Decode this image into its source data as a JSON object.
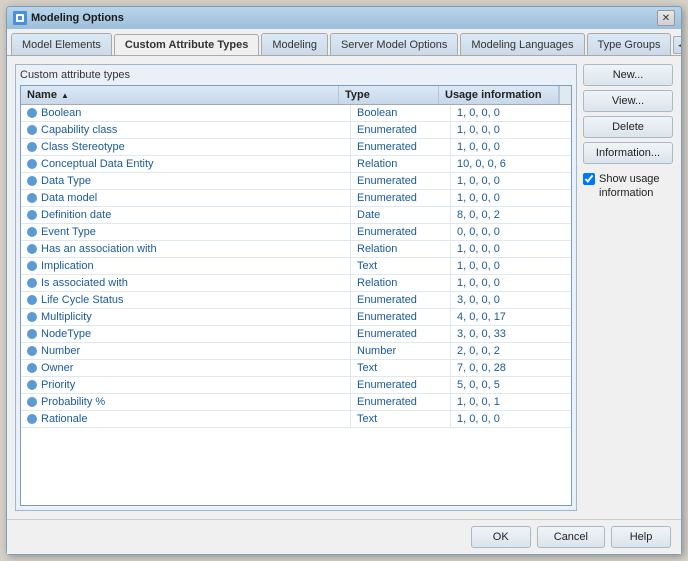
{
  "window": {
    "title": "Modeling Options",
    "icon": "gear-icon"
  },
  "tabs": [
    {
      "id": "model-elements",
      "label": "Model Elements",
      "active": false
    },
    {
      "id": "custom-attribute-types",
      "label": "Custom Attribute Types",
      "active": true
    },
    {
      "id": "modeling",
      "label": "Modeling",
      "active": false
    },
    {
      "id": "server-model-options",
      "label": "Server Model Options",
      "active": false
    },
    {
      "id": "modeling-languages",
      "label": "Modeling Languages",
      "active": false
    },
    {
      "id": "type-groups",
      "label": "Type Groups",
      "active": false
    }
  ],
  "panel": {
    "title": "Custom attribute types"
  },
  "table": {
    "columns": [
      {
        "id": "name",
        "label": "Name",
        "sortable": true,
        "sort": "asc"
      },
      {
        "id": "type",
        "label": "Type",
        "sortable": false
      },
      {
        "id": "usage",
        "label": "Usage information",
        "sortable": false
      }
    ],
    "rows": [
      {
        "name": "Boolean",
        "type": "Boolean",
        "usage": "1, 0, 0, 0"
      },
      {
        "name": "Capability class",
        "type": "Enumerated",
        "usage": "1, 0, 0, 0"
      },
      {
        "name": "Class Stereotype",
        "type": "Enumerated",
        "usage": "1, 0, 0, 0"
      },
      {
        "name": "Conceptual Data Entity",
        "type": "Relation",
        "usage": "10, 0, 0, 6"
      },
      {
        "name": "Data Type",
        "type": "Enumerated",
        "usage": "1, 0, 0, 0"
      },
      {
        "name": "Data model",
        "type": "Enumerated",
        "usage": "1, 0, 0, 0"
      },
      {
        "name": "Definition date",
        "type": "Date",
        "usage": "8, 0, 0, 2"
      },
      {
        "name": "Event Type",
        "type": "Enumerated",
        "usage": "0, 0, 0, 0"
      },
      {
        "name": "Has an association with",
        "type": "Relation",
        "usage": "1, 0, 0, 0"
      },
      {
        "name": "Implication",
        "type": "Text",
        "usage": "1, 0, 0, 0"
      },
      {
        "name": "Is associated with",
        "type": "Relation",
        "usage": "1, 0, 0, 0"
      },
      {
        "name": "Life Cycle Status",
        "type": "Enumerated",
        "usage": "3, 0, 0, 0"
      },
      {
        "name": "Multiplicity",
        "type": "Enumerated",
        "usage": "4, 0, 0, 17"
      },
      {
        "name": "NodeType",
        "type": "Enumerated",
        "usage": "3, 0, 0, 33"
      },
      {
        "name": "Number",
        "type": "Number",
        "usage": "2, 0, 0, 2"
      },
      {
        "name": "Owner",
        "type": "Text",
        "usage": "7, 0, 0, 28"
      },
      {
        "name": "Priority",
        "type": "Enumerated",
        "usage": "5, 0, 0, 5"
      },
      {
        "name": "Probability %",
        "type": "Enumerated",
        "usage": "1, 0, 0, 1"
      },
      {
        "name": "Rationale",
        "type": "Text",
        "usage": "1, 0, 0, 0"
      }
    ]
  },
  "actions": {
    "new_label": "New...",
    "view_label": "View...",
    "delete_label": "Delete",
    "information_label": "Information...",
    "show_usage_checked": true,
    "show_usage_label": "Show usage information"
  },
  "footer": {
    "ok_label": "OK",
    "cancel_label": "Cancel",
    "help_label": "Help"
  }
}
